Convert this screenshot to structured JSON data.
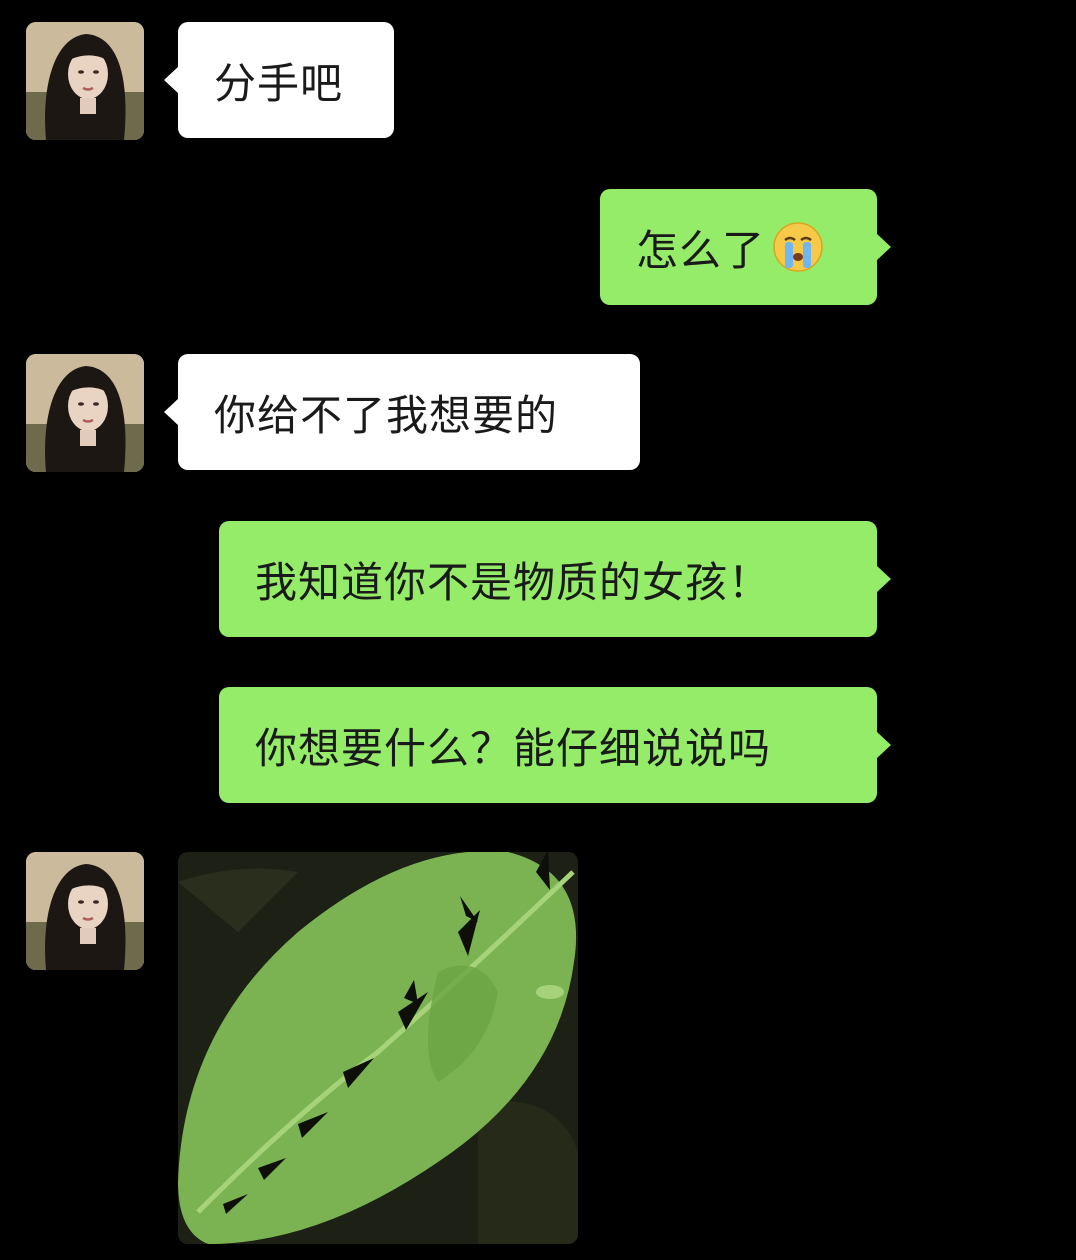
{
  "messages": [
    {
      "side": "left",
      "type": "text",
      "text": "分手吧"
    },
    {
      "side": "right",
      "type": "text",
      "text": "怎么了",
      "emoji": "crying-face-emoji"
    },
    {
      "side": "left",
      "type": "text",
      "text": "你给不了我想要的"
    },
    {
      "side": "right",
      "type": "text",
      "text": "我知道你不是物质的女孩！"
    },
    {
      "side": "right",
      "type": "text",
      "text": "你想要什么？能仔细说说吗"
    },
    {
      "side": "left",
      "type": "image",
      "image": "spiky-green-leaf-photo"
    }
  ],
  "colors": {
    "background": "#000000",
    "incoming_bubble": "#ffffff",
    "outgoing_bubble": "#95ec69",
    "text": "#1a1a1a"
  }
}
